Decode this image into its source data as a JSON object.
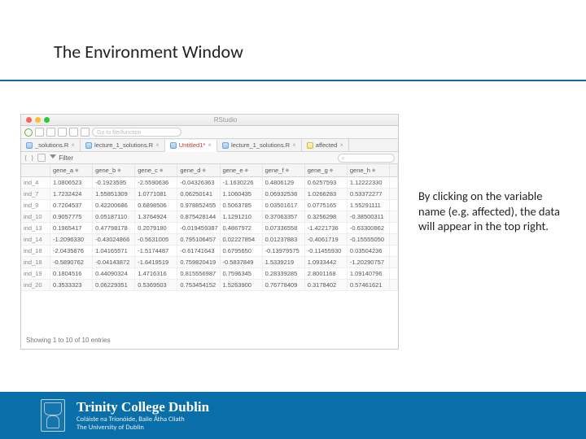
{
  "slide": {
    "title": "The Environment Window",
    "caption": "By clicking on the variable name (e.g. affected), the data will appear in the top right."
  },
  "rstudio": {
    "app_title": "RStudio",
    "goto_placeholder": "Go to file/function",
    "tabs": [
      {
        "label": "_solutions.R"
      },
      {
        "label": "lecture_1_solutions.R"
      },
      {
        "label": "Untitled1*"
      },
      {
        "label": "lecture_1_solutions.R"
      },
      {
        "label": "affected"
      }
    ],
    "filter_label": "Filter",
    "columns": [
      "gene_a",
      "gene_b",
      "gene_c",
      "gene_d",
      "gene_e",
      "gene_f",
      "gene_g",
      "gene_h"
    ],
    "rows": [
      {
        "id": "ind_4",
        "v": [
          "1.0806523",
          "-0.1923595",
          "-2.5590636",
          "-0.04326363",
          "-1.1630226",
          "0.4806129",
          "0.6257593",
          "1.12222330"
        ]
      },
      {
        "id": "ind_7",
        "v": [
          "1.7232424",
          "1.55851309",
          "1.0771081",
          "0.06250141",
          "1.1060435",
          "0.06932536",
          "1.0266283",
          "0.53372277"
        ]
      },
      {
        "id": "ind_9",
        "v": [
          "0.7204537",
          "0.42200686",
          "0.6898506",
          "0.978852455",
          "0.5063785",
          "0.03501617",
          "0.0775165",
          "1.55291111"
        ]
      },
      {
        "id": "ind_10",
        "v": [
          "0.9057775",
          "0.05187110",
          "1.3764924",
          "0.875428144",
          "1.1291210",
          "0.37063357",
          "0.3256298",
          "-0.38500311"
        ]
      },
      {
        "id": "ind_13",
        "v": [
          "0.1965417",
          "0.47798178",
          "0.2079180",
          "-0.019459387",
          "0.4867972",
          "0.07336558",
          "-1.4221736",
          "-0.63300862"
        ]
      },
      {
        "id": "ind_14",
        "v": [
          "-1.2096330",
          "-0.43024866",
          "-0.5631005",
          "0.795106457",
          "0.02227854",
          "0.01237883",
          "-0.4061719",
          "-0.15555050"
        ]
      },
      {
        "id": "ind_18",
        "v": [
          "-2.0435876",
          "1.04165571",
          "-1.5174487",
          "-0.61741643",
          "0.6795650",
          "-0.13979575",
          "-0.11455930",
          "0.03504236"
        ]
      },
      {
        "id": "ind_18",
        "v": [
          "-0.5890762",
          "-0.04143872",
          "-1.6419519",
          "0.759820419",
          "-0.5837849",
          "1.5339219",
          "1.0933442",
          "-1.20290757"
        ]
      },
      {
        "id": "ind_19",
        "v": [
          "0.1804516",
          "0.44090324",
          "1.4716316",
          "0.815556987",
          "0.7596345",
          "0.28339285",
          "2.8001168",
          "1.09140796"
        ]
      },
      {
        "id": "ind_20",
        "v": [
          "0.3533323",
          "0.06229351",
          "0.5369503",
          "0.753454152",
          "1.5263900",
          "0.76778409",
          "0.3178402",
          "0.57461621"
        ]
      }
    ],
    "footer_text": "Showing 1 to 10 of 10 entries"
  },
  "footer": {
    "university": "Trinity College Dublin",
    "irish": "Coláiste na Tríonóide, Baile Átha Cliath",
    "sub": "The University of Dublin"
  }
}
